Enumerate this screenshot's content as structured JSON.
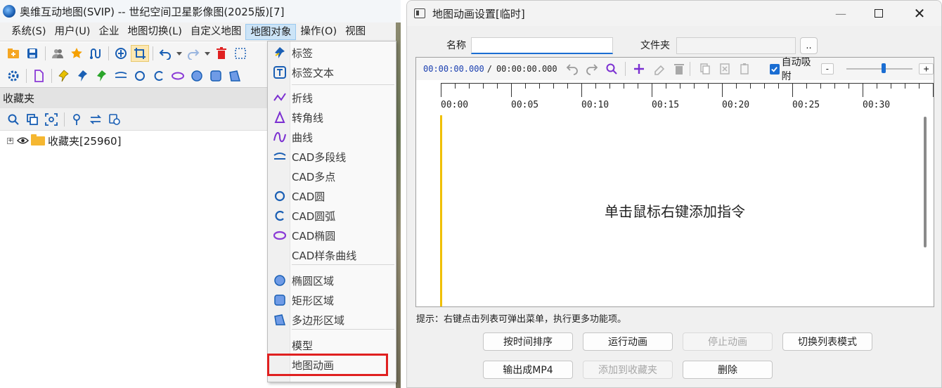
{
  "left_app": {
    "title": "奥维互动地图(SVIP) -- 世纪空间卫星影像图(2025版)[7]",
    "menu": [
      "系统(S)",
      "用户(U)",
      "企业",
      "地图切换(L)",
      "自定义地图",
      "地图对象",
      "操作(O)",
      "视图"
    ],
    "active_menu_index": 5,
    "favorites_header": "收藏夹",
    "tree_item": "收藏夹[25960]",
    "dropdown": {
      "items": [
        {
          "label": "标签",
          "icon": "pin-icon"
        },
        {
          "label": "标签文本",
          "icon": "text-label-icon"
        },
        {
          "label": "折线",
          "icon": "polyline-icon"
        },
        {
          "label": "转角线",
          "icon": "corner-line-icon"
        },
        {
          "label": "曲线",
          "icon": "curve-icon"
        },
        {
          "label": "CAD多段线",
          "icon": "cad-polyline-icon"
        },
        {
          "label": "CAD多点",
          "icon": ""
        },
        {
          "label": "CAD圆",
          "icon": "circle-icon"
        },
        {
          "label": "CAD圆弧",
          "icon": "arc-icon"
        },
        {
          "label": "CAD椭圆",
          "icon": "ellipse-icon"
        },
        {
          "label": "CAD样条曲线",
          "icon": ""
        },
        {
          "label": "椭圆区域",
          "icon": "ellipse-area-icon"
        },
        {
          "label": "矩形区域",
          "icon": "rect-area-icon"
        },
        {
          "label": "多边形区域",
          "icon": "polygon-area-icon"
        },
        {
          "label": "模型",
          "icon": ""
        },
        {
          "label": "地图动画",
          "icon": ""
        }
      ],
      "highlighted_item": "地图动画",
      "highlight_color": "#e02020"
    }
  },
  "dialog": {
    "title": "地图动画设置[临时]",
    "name_label": "名称",
    "name_value": "",
    "folder_label": "文件夹",
    "folder_value": "",
    "browse_button": "..",
    "time_current": "00:00:00.000",
    "time_separator": "/",
    "time_total": "00:00:00.000",
    "auto_snap_label": "自动吸附",
    "auto_snap_checked": true,
    "zoom_minus": "-",
    "zoom_plus": "+",
    "ruler_labels": [
      "00:00",
      "00:05",
      "00:10",
      "00:15",
      "00:20",
      "00:25",
      "00:30"
    ],
    "empty_hint": "单击鼠标右键添加指令",
    "tip": "提示：右键点击列表可弹出菜单，执行更多功能项。",
    "buttons": [
      {
        "label": "按时间排序",
        "enabled": true
      },
      {
        "label": "运行动画",
        "enabled": true
      },
      {
        "label": "停止动画",
        "enabled": false
      },
      {
        "label": "切换列表模式",
        "enabled": true
      },
      {
        "label": "输出成MP4",
        "enabled": true
      },
      {
        "label": "添加到收藏夹",
        "enabled": false
      },
      {
        "label": "删除",
        "enabled": true
      }
    ]
  },
  "colors": {
    "accent": "#1a6dd2",
    "playhead": "#f0c000",
    "time_text": "#1a3fb0"
  }
}
